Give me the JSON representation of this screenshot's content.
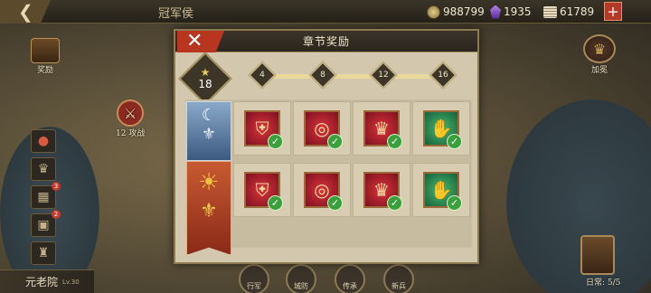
{
  "topbar": {
    "title": "冠军侯",
    "resources": [
      {
        "icon": "silver-coin-icon",
        "value": "988799"
      },
      {
        "icon": "purple-gem-icon",
        "value": "1935"
      },
      {
        "icon": "scroll-icon",
        "value": "61789"
      }
    ]
  },
  "map": {
    "treasure_label": "奖励",
    "campaign_label": "攻战",
    "campaign_number": "12",
    "crown_label": "加冕",
    "side_badges": {
      "item3": "3",
      "item4": "2"
    },
    "senate": {
      "name": "元老院",
      "level": "Lv.30"
    },
    "bottom_nav": [
      "行军",
      "城防",
      "传承",
      "新兵"
    ],
    "chest_label": "日常: 5/5"
  },
  "dialog": {
    "title": "章节奖励",
    "star_total": "18",
    "milestones": [
      "4",
      "8",
      "12",
      "16"
    ],
    "rows": [
      {
        "tier": "silver-eagle-banner",
        "items": [
          {
            "icon": "armor-icon",
            "bg": "red",
            "claimed": true
          },
          {
            "icon": "ring-icon",
            "bg": "red",
            "claimed": true
          },
          {
            "icon": "crown-icon",
            "bg": "red",
            "claimed": true
          },
          {
            "icon": "gauntlet-icon",
            "bg": "green",
            "claimed": true
          }
        ]
      },
      {
        "tier": "gold-eagle-banner",
        "items": [
          {
            "icon": "armor-icon",
            "bg": "red",
            "claimed": true
          },
          {
            "icon": "ring-icon",
            "bg": "red",
            "claimed": true
          },
          {
            "icon": "crown-icon",
            "bg": "red",
            "claimed": true
          },
          {
            "icon": "gauntlet-icon",
            "bg": "green",
            "claimed": true
          }
        ]
      }
    ]
  },
  "colors": {
    "accent_red": "#b8361f",
    "check_green": "#3aa03c",
    "panel_bg": "#d3c7ad"
  }
}
